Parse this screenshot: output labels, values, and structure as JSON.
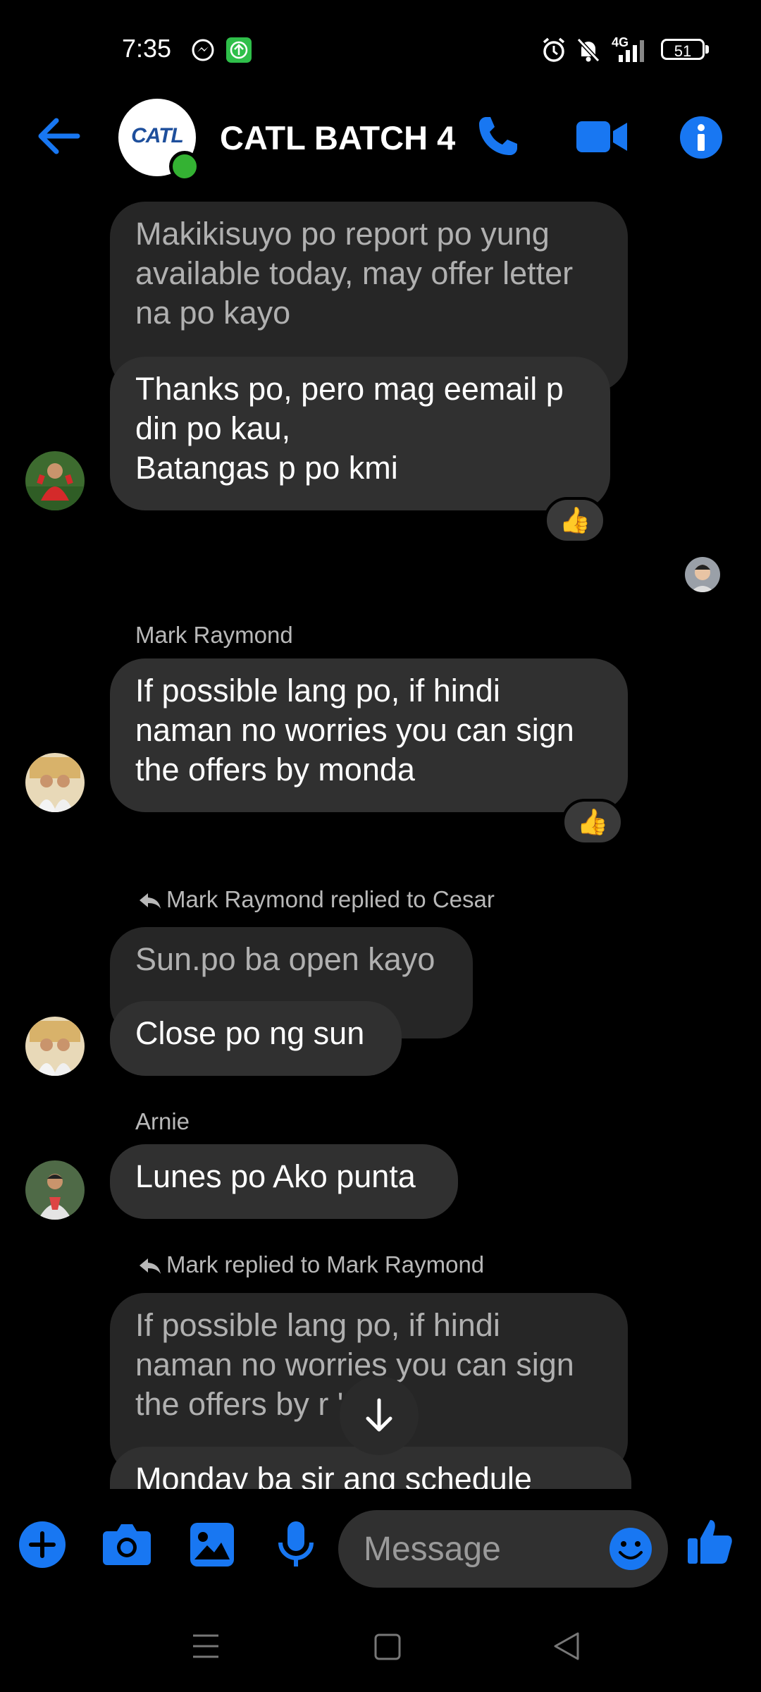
{
  "status_bar": {
    "time": "7:35",
    "battery": "51",
    "network": "4G"
  },
  "header": {
    "title": "CATL BATCH 4",
    "logo_text": "CATL"
  },
  "messages": {
    "q1_text": "Makikisuyo po report po yung\navailable today, may offer letter\nna po kayo",
    "m1_text": "Thanks po, pero mag eemail p\ndin po kau,\nBatangas p po kmi",
    "m1_reaction": "👍",
    "m2_sender": "Mark Raymond",
    "m2_text": "If possible lang po, if hindi\nnaman no worries you can sign\nthe offers by monda",
    "m2_reaction": "👍",
    "m3_reply_note": "Mark Raymond replied to Cesar",
    "q3_text": "Sun.po ba open kayo",
    "m3_text": "Close po ng sun",
    "m4_sender": "Arnie",
    "m4_text": "Lunes po Ako punta",
    "m5_reply_note": "Mark replied to Mark Raymond",
    "q5_text": "If possible lang po, if hindi\nnaman no worries you can sign\nthe offers by r      'a",
    "m5_text": "Monday ba sir ang schedule"
  },
  "composer": {
    "placeholder": "Message"
  },
  "colors": {
    "accent": "#1877f2",
    "bubble": "#303030",
    "background": "#000000"
  },
  "icons": [
    "back-arrow-icon",
    "phone-icon",
    "video-icon",
    "info-icon",
    "plus-icon",
    "camera-icon",
    "gallery-icon",
    "mic-icon",
    "emoji-icon",
    "like-icon",
    "arrow-down-icon"
  ]
}
